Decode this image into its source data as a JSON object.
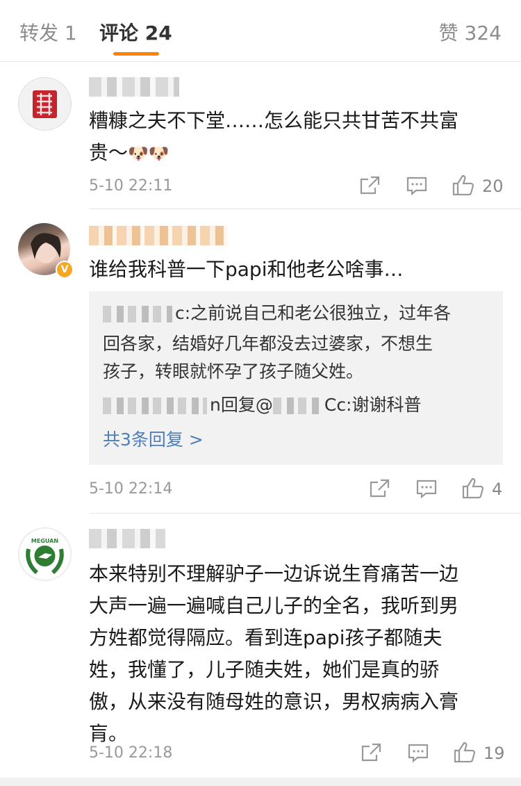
{
  "tabs": {
    "repost": "转发 1",
    "comment": "评论 24",
    "like": "赞 324",
    "accent_color": "#ff8200"
  },
  "comments": [
    {
      "text_line1": "糟糠之夫不下堂……怎么能只共甘苦不共富",
      "text_line2": "贵～",
      "emoji": "🐶🐶",
      "time": "5-10 22:11",
      "likes": "20",
      "avatar": "seal-logo"
    },
    {
      "text": "谁给我科普一下papi和他老公啥事…",
      "time": "5-10 22:14",
      "likes": "4",
      "avatar": "user-photo",
      "verified_badge": "V",
      "replies": {
        "first_suffix": "c:",
        "first_line1": "之前说自己和老公很独立，过年各",
        "first_line2": "回各家，结婚好几年都没去过婆家，不想生",
        "first_line3": "孩子，转眼就怀孕了孩子随父姓。",
        "second_part1": "n回复@",
        "second_part2": "Cc:谢谢科普",
        "more": "共3条回复 >"
      }
    },
    {
      "lines": [
        "本来特别不理解驴子一边诉说生育痛苦一边",
        "大声一遍一遍喊自己儿子的全名，我听到男",
        "方姓都觉得隔应。看到连papi孩子都随夫",
        "姓，我懂了，儿子随夫姓，她们是真的骄",
        "傲，从来没有随母姓的意识，男权病病入膏",
        "肓。"
      ],
      "time": "5-10 22:18",
      "likes": "19",
      "avatar": "laurel-logo",
      "avatar_text": "MEGUAN"
    }
  ]
}
